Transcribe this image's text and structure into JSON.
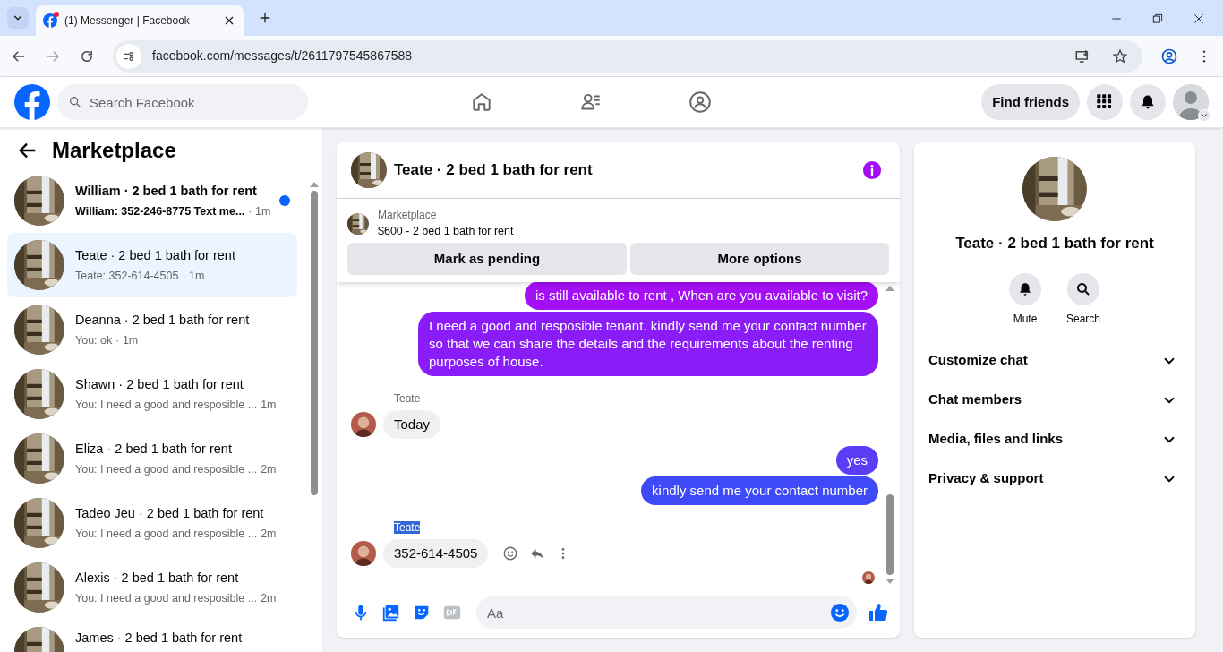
{
  "browser": {
    "tab_title": "(1) Messenger | Facebook",
    "tab_notification": true,
    "url": "facebook.com/messages/t/2611797545867588"
  },
  "header": {
    "search_placeholder": "Search Facebook",
    "find_friends": "Find friends"
  },
  "sidebar": {
    "title": "Marketplace",
    "conversations": [
      {
        "name": "William · 2 bed 1 bath for rent",
        "preview": "William: 352-246-8775 Text me...",
        "time": "· 1m",
        "unread": true,
        "selected": false
      },
      {
        "name": "Teate · 2 bed 1 bath for rent",
        "preview": "Teate: 352-614-4505",
        "time": "· 1m",
        "unread": false,
        "selected": true
      },
      {
        "name": "Deanna · 2 bed 1 bath for rent",
        "preview": "You: ok",
        "time": "· 1m",
        "unread": false,
        "selected": false
      },
      {
        "name": "Shawn · 2 bed 1 bath for rent",
        "preview": "You: I need a good and resposible ...",
        "time": "1m",
        "unread": false,
        "selected": false
      },
      {
        "name": "Eliza · 2 bed 1 bath for rent",
        "preview": "You: I need a good and resposible ...",
        "time": "2m",
        "unread": false,
        "selected": false
      },
      {
        "name": "Tadeo Jeu · 2 bed 1 bath for rent",
        "preview": "You: I need a good and resposible ...",
        "time": "2m",
        "unread": false,
        "selected": false
      },
      {
        "name": "Alexis · 2 bed 1 bath for rent",
        "preview": "You: I need a good and resposible ...",
        "time": "2m",
        "unread": false,
        "selected": false
      },
      {
        "name": "James · 2 bed 1 bath for rent",
        "unread": false,
        "selected": false
      }
    ]
  },
  "chat": {
    "title": "Teate · 2 bed 1 bath for rent",
    "listing": {
      "label": "Marketplace",
      "title": "$600 - 2 bed 1 bath for rent"
    },
    "buttons": [
      "Mark as pending",
      "More options"
    ],
    "messages": [
      {
        "kind": "outgoing",
        "text": "is still available to rent , When are you available to visit?",
        "color": "#a40ff6"
      },
      {
        "kind": "outgoing",
        "text": "I need a good and resposible tenant.  kindly send me your contact number so that we can share the details and the requirements about the renting purposes of house.",
        "color": "#8a1cf8"
      },
      {
        "kind": "sender",
        "text": "Teate",
        "highlighted": false
      },
      {
        "kind": "incoming",
        "text": "Today",
        "actions": false
      },
      {
        "kind": "outgoing",
        "text": "yes",
        "color": "#5a3ef6"
      },
      {
        "kind": "outgoing",
        "text": "kindly send me your contact number",
        "color": "#3e4af5"
      },
      {
        "kind": "sender",
        "text": "Teate",
        "highlighted": true
      },
      {
        "kind": "incoming",
        "text": "352-614-4505",
        "actions": true
      }
    ],
    "composer_placeholder": "Aa"
  },
  "info_panel": {
    "title": "Teate · 2 bed 1 bath for rent",
    "actions": [
      {
        "kind": "bell",
        "label": "Mute"
      },
      {
        "kind": "search",
        "label": "Search"
      }
    ],
    "sections": [
      {
        "label": "Customize chat",
        "expanded": false
      },
      {
        "label": "Chat members",
        "expanded": false
      },
      {
        "label": "Media, files and links",
        "expanded": false
      },
      {
        "label": "Privacy & support",
        "expanded": false
      }
    ]
  }
}
